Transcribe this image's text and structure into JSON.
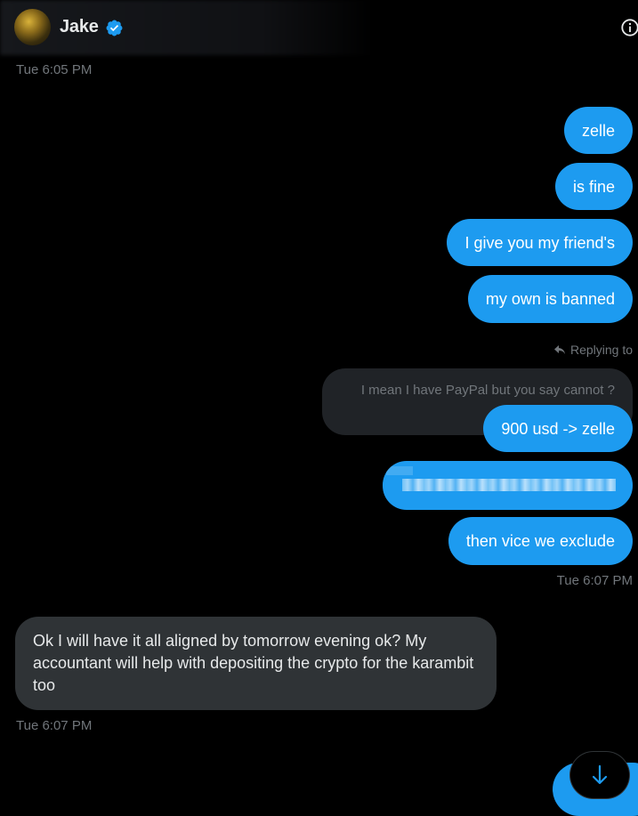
{
  "header": {
    "name": "Jake",
    "verified_icon": "verified-badge-icon",
    "info_icon": "info-icon",
    "avatar": "avatar"
  },
  "timestamps": {
    "top": "Tue 6:05 PM",
    "after_sent": "Tue 6:07 PM",
    "after_received": "Tue 6:07 PM"
  },
  "messages": {
    "m1": "zelle",
    "m2": "is fine",
    "m3": "I give you my friend's",
    "m4": "my own is banned",
    "m5": "900 usd -> zelle",
    "m6": "then vice we exclude",
    "received1": "Ok I will have it all aligned by tomorrow evening ok? My accountant will help with depositing the crypto for the karambit too"
  },
  "reply": {
    "indicator": "Replying to",
    "quoted_text": "I mean I have PayPal but you say cannot ?"
  },
  "colors": {
    "background": "#000000",
    "outgoing_bubble": "#1d9bf0",
    "incoming_bubble": "#2f3336",
    "quoted_bubble": "#202327",
    "muted_text": "#71767b"
  },
  "controls": {
    "scroll_down_icon": "arrow-down-icon"
  }
}
